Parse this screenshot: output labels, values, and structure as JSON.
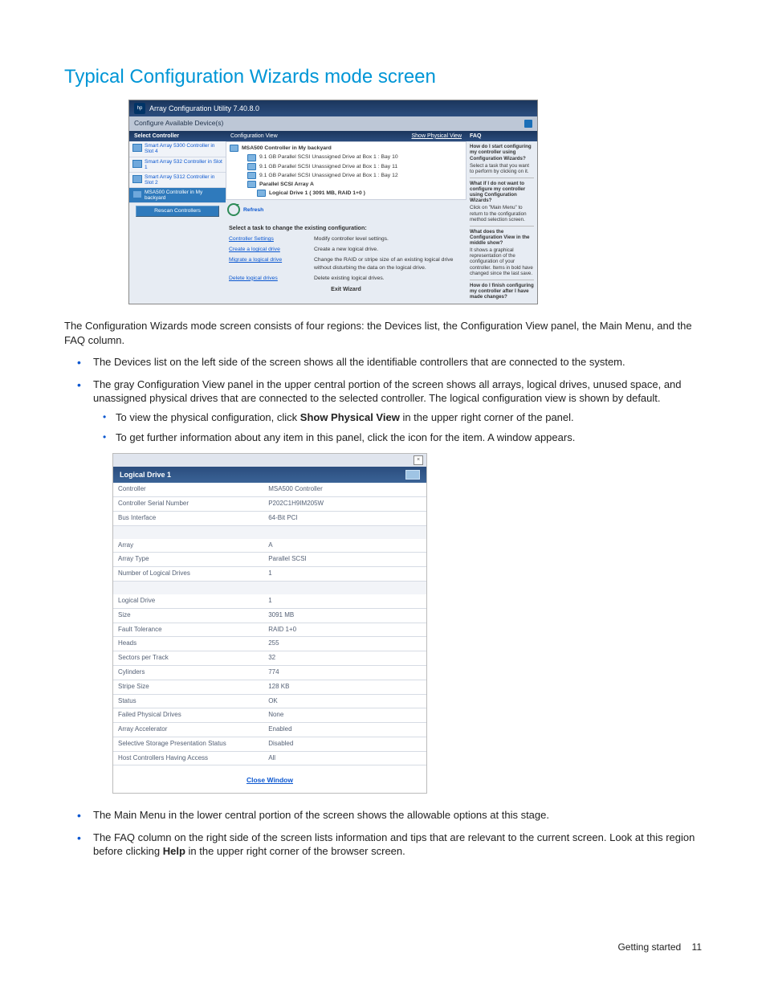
{
  "heading": "Typical Configuration Wizards mode screen",
  "acu": {
    "title": "Array Configuration Utility 7.40.8.0",
    "bar2": "Configure Available Device(s)",
    "left_header": "Select Controller",
    "rescan": "Rescan Controllers",
    "devices": [
      "Smart Array 5300 Controller in Slot 4",
      "Smart Array 532 Controller in Slot 1",
      "Smart Array 5312 Controller in Slot 2",
      "MSA500 Controller in My backyard"
    ],
    "cv_header": "Configuration View",
    "cv_link": "Show Physical View",
    "cv_lines": [
      "MSA500 Controller in My backyard",
      "9.1 GB Parallel SCSI Unassigned Drive at Box 1 : Bay 10",
      "9.1 GB Parallel SCSI Unassigned Drive at Box 1 : Bay 11",
      "9.1 GB Parallel SCSI Unassigned Drive at Box 1 : Bay 12",
      "Parallel SCSI Array A",
      "Logical Drive 1 ( 3091 MB, RAID 1+0 )"
    ],
    "refresh": "Refresh",
    "task_intro": "Select a task to change the existing configuration:",
    "tasks": [
      {
        "link": "Controller Settings",
        "desc": "Modify controller level settings."
      },
      {
        "link": "Create a logical drive",
        "desc": "Create a new logical drive."
      },
      {
        "link": "Migrate a logical drive",
        "desc": "Change the RAID or stripe size of an existing logical drive without disturbing the data on the logical drive."
      },
      {
        "link": "Delete logical drives",
        "desc": "Delete existing logical drives."
      }
    ],
    "exit": "Exit Wizard",
    "faq_header": "FAQ",
    "faq": [
      {
        "q": "How do I start configuring my controller using Configuration Wizards?",
        "a": "Select a task that you want to perform by clicking on it."
      },
      {
        "q": "What if I do not want to configure my controller using Configuration Wizards?",
        "a": "Click on \"Main Menu\" to return to the configuration method selection screen."
      },
      {
        "q": "What does the Configuration View in the middle show?",
        "a": "It shows a graphical representation of the configuration of your controller. Items in bold have changed since the last save."
      },
      {
        "q": "How do I finish configuring my controller after I have made changes?",
        "a": ""
      }
    ]
  },
  "para_intro": "The Configuration Wizards mode screen consists of four regions: the Devices list, the Configuration View panel, the Main Menu, and the FAQ column.",
  "bullet1": "The Devices list on the left side of the screen shows all the identifiable controllers that are connected to the system.",
  "bullet2": "The gray Configuration View panel in the upper central portion of the screen shows all arrays, logical drives, unused space, and unassigned physical drives that are connected to the selected controller. The logical configuration view is shown by default.",
  "bullet2a_pre": "To view the physical configuration, click ",
  "bullet2a_bold": "Show Physical View",
  "bullet2a_post": " in the upper right corner of the panel.",
  "bullet2b": "To get further information about any item in this panel, click the icon for the item. A window appears.",
  "ldw": {
    "title": "Logical Drive 1",
    "close": "Close Window",
    "rows": [
      [
        "Controller",
        "MSA500 Controller"
      ],
      [
        "Controller Serial Number",
        "P202C1H9IM205W"
      ],
      [
        "Bus Interface",
        "64-Bit PCI"
      ],
      [
        "__spacer__",
        ""
      ],
      [
        "Array",
        "A"
      ],
      [
        "Array Type",
        "Parallel SCSI"
      ],
      [
        "Number of Logical Drives",
        "1"
      ],
      [
        "__spacer__",
        ""
      ],
      [
        "Logical Drive",
        "1"
      ],
      [
        "Size",
        "3091 MB"
      ],
      [
        "Fault Tolerance",
        "RAID 1+0"
      ],
      [
        "Heads",
        "255"
      ],
      [
        "Sectors per Track",
        "32"
      ],
      [
        "Cylinders",
        "774"
      ],
      [
        "Stripe Size",
        "128 KB"
      ],
      [
        "Status",
        "OK"
      ],
      [
        "Failed Physical Drives",
        "None"
      ],
      [
        "Array Accelerator",
        "Enabled"
      ],
      [
        "Selective Storage Presentation Status",
        "Disabled"
      ],
      [
        "Host Controllers Having Access",
        "All"
      ]
    ]
  },
  "bullet3": "The Main Menu in the lower central portion of the screen shows the allowable options at this stage.",
  "bullet4_pre": "The FAQ column on the right side of the screen lists information and tips that are relevant to the current screen. Look at this region before clicking ",
  "bullet4_bold": "Help",
  "bullet4_post": " in the upper right corner of the browser screen.",
  "footer_label": "Getting started",
  "footer_page": "11"
}
